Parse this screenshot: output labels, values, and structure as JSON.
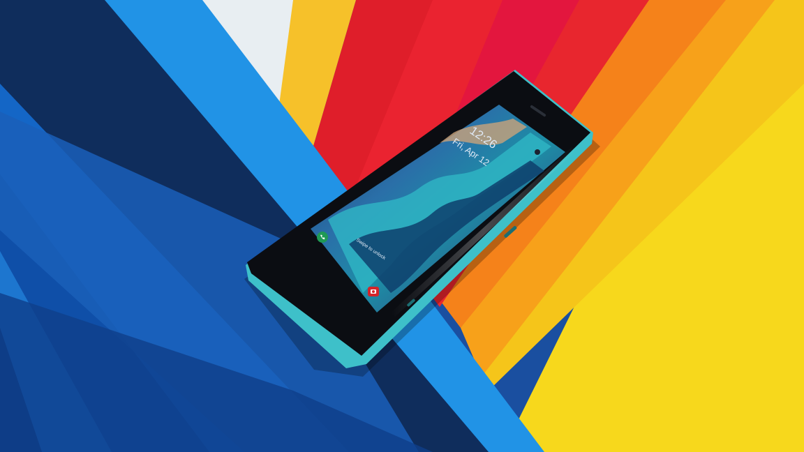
{
  "lock_screen": {
    "time": "12:26",
    "date": "Fri, Apr 12",
    "swipe_hint": "Swipe to unlock",
    "phone_icon": "phone-icon",
    "camera_icon": "camera-icon"
  },
  "colors": {
    "navy": "#0d2a57",
    "blue": "#1464c8",
    "sky": "#1e8fe0",
    "white": "#e8eef2",
    "yellow": "#f8cd22",
    "red": "#e52530",
    "crimson": "#e8153f",
    "orange": "#f5851a",
    "gold": "#f7d21a",
    "phone_frame": "#3ec0c9"
  }
}
